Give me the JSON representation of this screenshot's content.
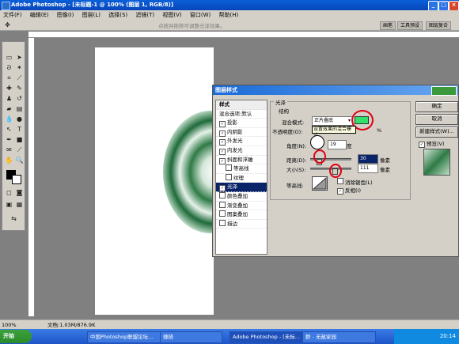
{
  "app": {
    "title": "Adobe Photoshop - [未标题-1 @ 100% (图层 1, RGB/8)]"
  },
  "menu": [
    "文件(F)",
    "编辑(E)",
    "图像(I)",
    "图层(L)",
    "选择(S)",
    "滤镜(T)",
    "视图(V)",
    "窗口(W)",
    "帮助(H)"
  ],
  "options": {
    "hint": "点按并拖移可调整光泽效果。",
    "palettes": [
      "画笔",
      "工具预设",
      "图层复合"
    ]
  },
  "dialog": {
    "title": "图层样式",
    "styles_header": "样式",
    "blend_default": "混合选项:默认",
    "effects": [
      {
        "label": "投影",
        "checked": "✓"
      },
      {
        "label": "内阴影",
        "checked": "✓"
      },
      {
        "label": "外发光",
        "checked": "✓"
      },
      {
        "label": "内发光",
        "checked": "✓"
      },
      {
        "label": "斜面和浮雕",
        "checked": "✓"
      },
      {
        "label": "等高线",
        "checked": ""
      },
      {
        "label": "纹理",
        "checked": ""
      },
      {
        "label": "光泽",
        "checked": "✓"
      },
      {
        "label": "颜色叠加",
        "checked": ""
      },
      {
        "label": "渐变叠加",
        "checked": ""
      },
      {
        "label": "图案叠加",
        "checked": ""
      },
      {
        "label": "描边",
        "checked": ""
      }
    ],
    "section_title": "光泽",
    "structure_title": "结构",
    "blend_mode_label": "混合模式:",
    "blend_mode_value": "正片叠底",
    "color_swatch": "#33e06a",
    "opacity_label": "不透明度(O):",
    "opacity_tooltip": "设置效果的混合模式",
    "opacity_unit": "%",
    "angle_label": "角度(N):",
    "angle_value": "19",
    "angle_unit": "度",
    "distance_label": "距离(D):",
    "distance_value": "30",
    "distance_unit": "像素",
    "size_label": "大小(S):",
    "size_value": "111",
    "size_unit": "像素",
    "contour_label": "等高线:",
    "antialias_label": "消除锯齿(L)",
    "invert_label": "反相(I)",
    "buttons": {
      "ok": "确定",
      "cancel": "取消",
      "new_style": "新建样式(W)...",
      "preview": "预览(V)"
    }
  },
  "status": {
    "zoom": "100%",
    "doc": "文档:1.03M/876.9K"
  },
  "taskbar": {
    "start": "开始",
    "tasks": [
      "中国Photoshop联盟论坛...",
      "缠绕",
      "Adobe Photoshop - [未标...",
      "群 - 无敌家园"
    ],
    "time": "20:14"
  }
}
